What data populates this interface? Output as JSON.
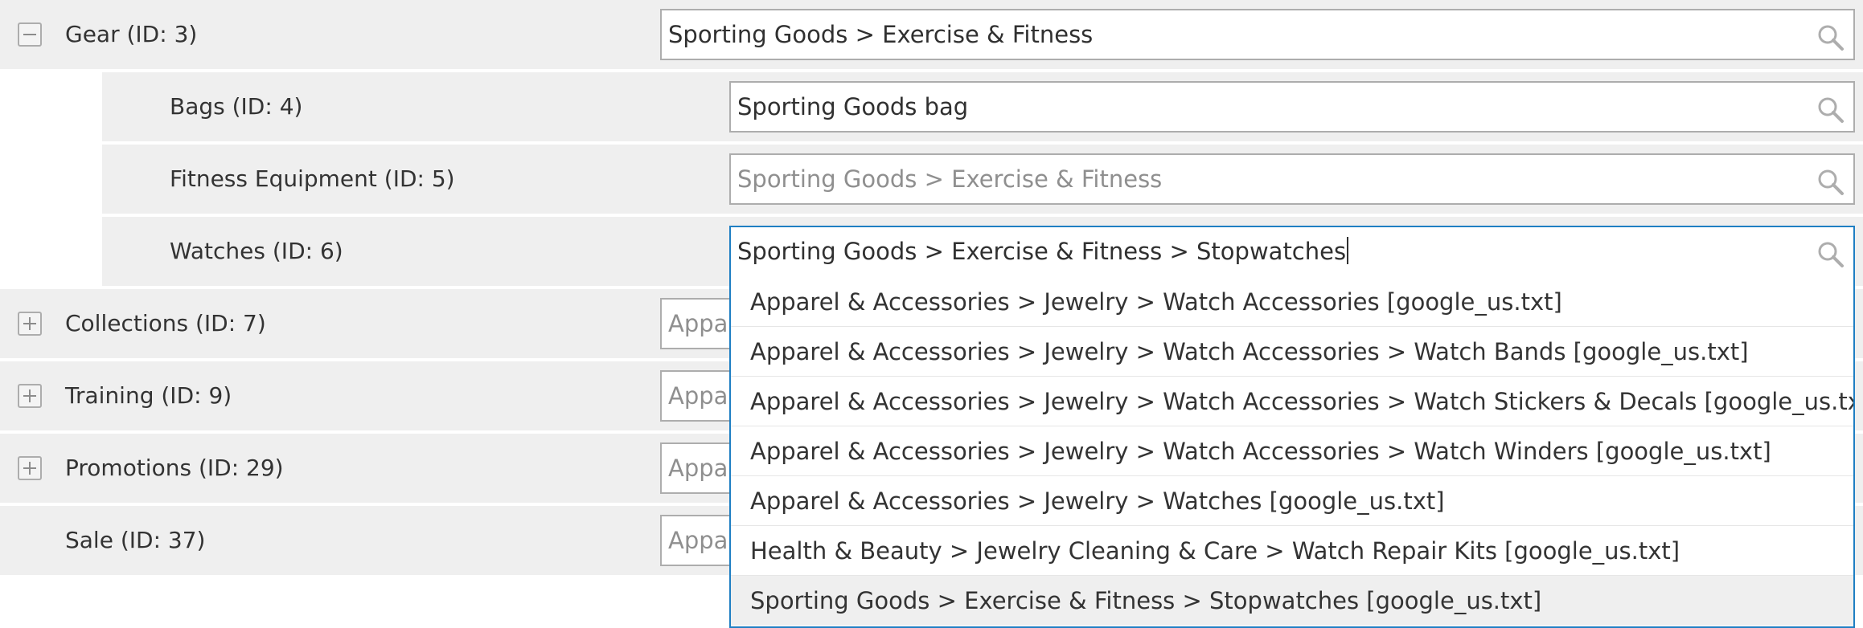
{
  "rows": [
    {
      "label": "Gear (ID: 3)",
      "toggle": "collapse",
      "value": "Sporting Goods > Exercise & Fitness",
      "placeholder": false
    },
    {
      "label": "Bags (ID: 4)",
      "value": "Sporting Goods  bag",
      "placeholder": false
    },
    {
      "label": "Fitness Equipment (ID: 5)",
      "value": "Sporting Goods > Exercise & Fitness",
      "placeholder": true
    },
    {
      "label": "Watches (ID: 6)",
      "value": "Sporting Goods > Exercise & Fitness > Stopwatches",
      "placeholder": false
    },
    {
      "label": "Collections (ID: 7)",
      "toggle": "expand",
      "value": "Apparel & Accessories",
      "placeholder": true
    },
    {
      "label": "Training (ID: 9)",
      "toggle": "expand",
      "value": "Apparel & Accessories",
      "placeholder": true
    },
    {
      "label": "Promotions (ID: 29)",
      "toggle": "expand",
      "value": "Apparel & Accessories",
      "placeholder": true
    },
    {
      "label": "Sale (ID: 37)",
      "value": "Apparel & Accessories",
      "placeholder": true
    }
  ],
  "suggestions": [
    "Apparel & Accessories > Jewelry > Watch Accessories [google_us.txt]",
    "Apparel & Accessories > Jewelry > Watch Accessories > Watch Bands [google_us.txt]",
    "Apparel & Accessories > Jewelry > Watch Accessories > Watch Stickers & Decals [google_us.txt]",
    "Apparel & Accessories > Jewelry > Watch Accessories > Watch Winders [google_us.txt]",
    "Apparel & Accessories > Jewelry > Watches [google_us.txt]",
    "Health & Beauty > Jewelry Cleaning & Care > Watch Repair Kits [google_us.txt]",
    "Sporting Goods > Exercise & Fitness > Stopwatches [google_us.txt]"
  ],
  "icons": {
    "search": "search-icon",
    "collapse": "minus-square-icon",
    "expand": "plus-square-icon"
  },
  "colors": {
    "row_bg": "#efefef",
    "focus_border": "#1f7fc3",
    "field_border": "#adadad",
    "placeholder_text": "#8f8f8f"
  }
}
